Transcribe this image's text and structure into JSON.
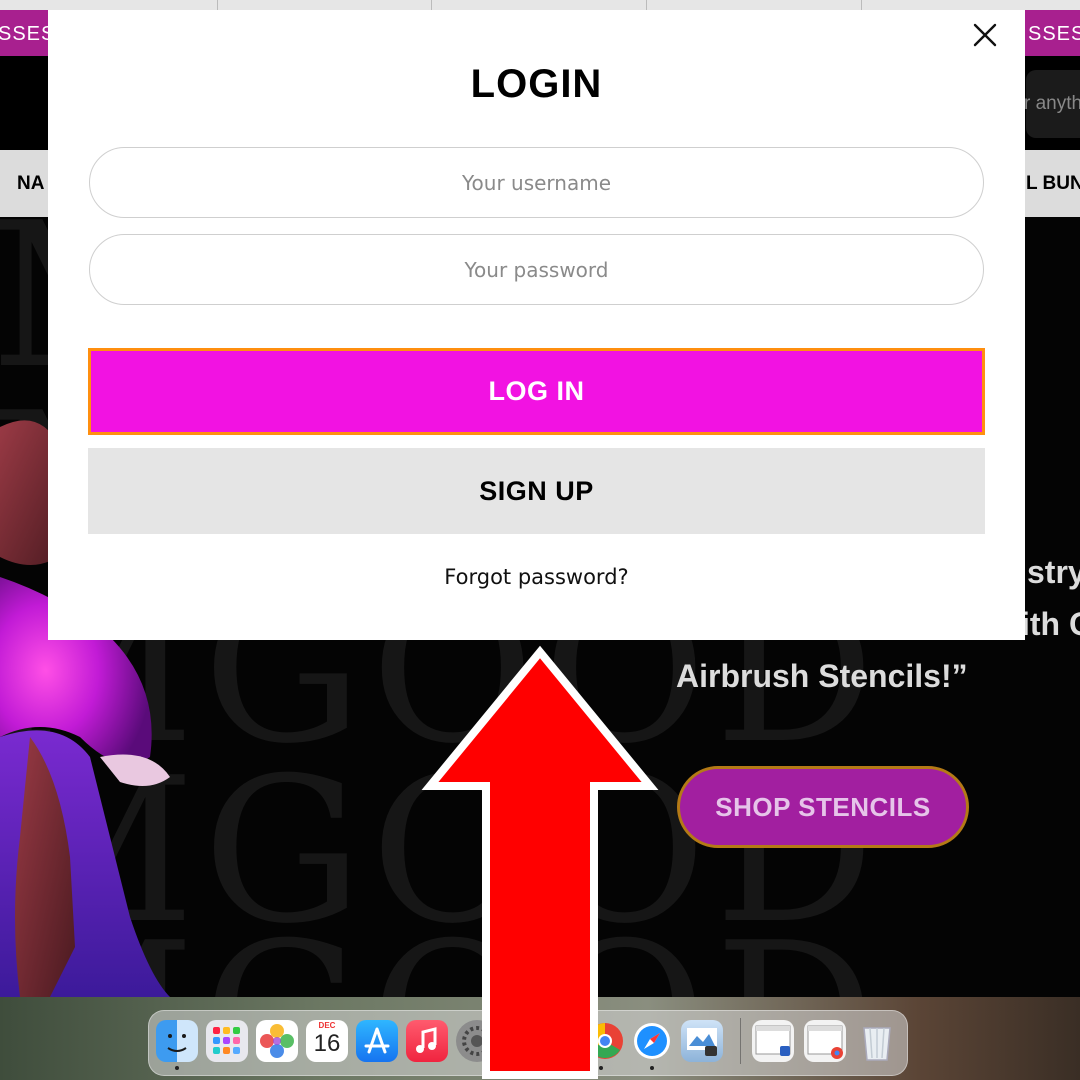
{
  "promo": {
    "left_text": "SSES",
    "right_text": "SSES A"
  },
  "header": {
    "search_placeholder": "r anyth"
  },
  "nav": {
    "left_item": "NA",
    "right_item": "L BUN"
  },
  "hero": {
    "watermark": "MGOOD",
    "quote_line1": "stry",
    "quote_line2": "ith C",
    "quote_line3": "Airbrush Stencils!”",
    "shop_button": "SHOP STENCILS"
  },
  "modal": {
    "title": "LOGIN",
    "username_placeholder": "Your username",
    "password_placeholder": "Your password",
    "login_button": "LOG IN",
    "signup_button": "SIGN UP",
    "forgot_link": "Forgot password?"
  },
  "dock": {
    "calendar_month": "DEC",
    "calendar_day": "16",
    "icons": [
      "finder-icon",
      "launchpad-icon",
      "photos-icon",
      "calendar-icon",
      "app-store-icon",
      "music-icon",
      "system-settings-icon",
      "chrome-icon",
      "safari-icon",
      "preview-icon",
      "document-window-icon",
      "chrome-window-icon",
      "trash-icon"
    ]
  },
  "colors": {
    "login_button_bg": "#f212e2",
    "login_button_border": "#ff8f0f",
    "promo_bg": "#a8208f",
    "shop_button_bg": "#a21fa0",
    "arrow_fill": "#ff0000"
  }
}
